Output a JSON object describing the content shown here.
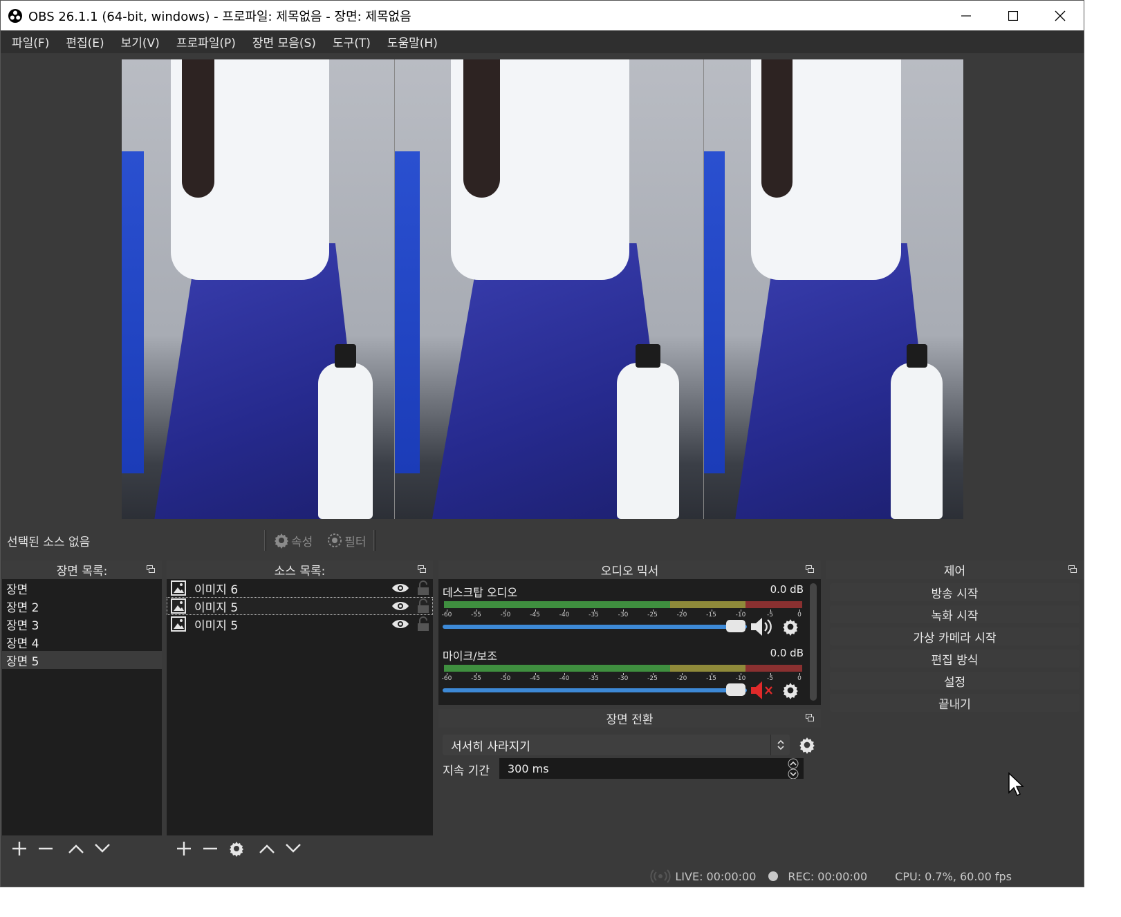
{
  "window": {
    "title": "OBS 26.1.1 (64-bit, windows) - 프로파일: 제목없음 - 장면: 제목없음",
    "controls": [
      "minimize-icon",
      "maximize-icon",
      "close-icon"
    ]
  },
  "menu": [
    "파일(F)",
    "편집(E)",
    "보기(V)",
    "프로파일(P)",
    "장면 모음(S)",
    "도구(T)",
    "도움말(H)"
  ],
  "source_toolbar": {
    "status": "선택된 소스 없음",
    "properties_label": "속성",
    "filters_label": "필터"
  },
  "scenes": {
    "title": "장면 목록:",
    "items": [
      "장면",
      "장면 2",
      "장면 3",
      "장면 4",
      "장면 5"
    ],
    "active_index": 4
  },
  "sources": {
    "title": "소스 목록:",
    "items": [
      "이미지 6",
      "이미지 5",
      "이미지 5"
    ],
    "selected_index": 1
  },
  "mixer": {
    "title": "오디오 믹서",
    "channels": [
      {
        "name": "데스크탑 오디오",
        "db": "0.0 dB",
        "muted": false
      },
      {
        "name": "마이크/보조",
        "db": "0.0 dB",
        "muted": true
      }
    ],
    "ticks": [
      "-60",
      "-55",
      "-50",
      "-45",
      "-40",
      "-35",
      "-30",
      "-25",
      "-20",
      "-15",
      "-10",
      "-5",
      "0"
    ]
  },
  "transitions": {
    "title": "장면 전환",
    "selected": "서서히 사라지기",
    "duration_label": "지속 기간",
    "duration_value": "300 ms"
  },
  "controls": {
    "title": "제어",
    "buttons": [
      "방송 시작",
      "녹화 시작",
      "가상 카메라 시작",
      "편집 방식",
      "설정",
      "끝내기"
    ]
  },
  "status": {
    "live": "LIVE: 00:00:00",
    "rec": "REC: 00:00:00",
    "cpu": "CPU: 0.7%, 60.00 fps"
  },
  "colors": {
    "panel_bg": "#3a3a3a",
    "list_bg": "#1e1e1e",
    "slider_blue": "#3d89d6",
    "mute_red": "#e02a2a"
  }
}
